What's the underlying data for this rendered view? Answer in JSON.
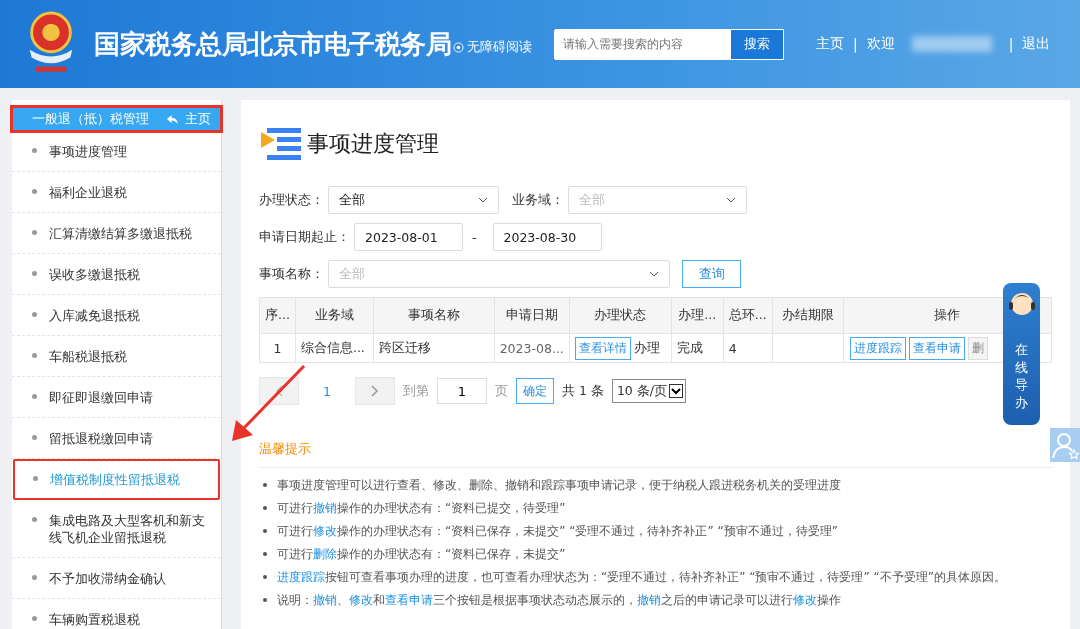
{
  "header": {
    "title": "国家税务总局北京市电子税务局",
    "accessibility": "无障碍阅读",
    "search": {
      "placeholder": "请输入需要搜索的内容"
    },
    "search_button": "搜索",
    "nav": [
      {
        "kind": "link",
        "label": "主页"
      },
      {
        "kind": "sep",
        "label": "|"
      },
      {
        "kind": "link",
        "label": "欢迎"
      },
      {
        "kind": "blurred"
      },
      {
        "kind": "sep",
        "label": "|"
      },
      {
        "kind": "link",
        "label": "退出"
      }
    ]
  },
  "sidebar": {
    "header": {
      "title": "一般退（抵）税管理",
      "home_link": "主页",
      "highlighted": true
    },
    "items": [
      {
        "label": "事项进度管理",
        "selected": false,
        "highlighted": false
      },
      {
        "label": "福利企业退税",
        "selected": false,
        "highlighted": false
      },
      {
        "label": "汇算清缴结算多缴退抵税",
        "selected": false,
        "highlighted": false
      },
      {
        "label": "误收多缴退抵税",
        "selected": false,
        "highlighted": false
      },
      {
        "label": "入库减免退抵税",
        "selected": false,
        "highlighted": false
      },
      {
        "label": "车船税退抵税",
        "selected": false,
        "highlighted": false
      },
      {
        "label": "即征即退缴回申请",
        "selected": false,
        "highlighted": false
      },
      {
        "label": "留抵退税缴回申请",
        "selected": false,
        "highlighted": false
      },
      {
        "label": "增值税制度性留抵退税",
        "selected": true,
        "highlighted": true
      },
      {
        "label": "集成电路及大型客机和新支线飞机企业留抵退税",
        "selected": false,
        "highlighted": false
      },
      {
        "label": "不予加收滞纳金确认",
        "selected": false,
        "highlighted": false
      },
      {
        "label": "车辆购置税退税",
        "selected": false,
        "highlighted": false
      }
    ]
  },
  "main": {
    "title": "事项进度管理",
    "filters": {
      "status": {
        "label": "办理状态：",
        "value": "全部"
      },
      "domain": {
        "label": "业务域：",
        "placeholder": "全部"
      },
      "date_range": {
        "label": "申请日期起止：",
        "start": "2023-08-01",
        "separator": "-",
        "end": "2023-08-30"
      },
      "item_name": {
        "label": "事项名称：",
        "placeholder": "全部"
      },
      "query_button": "查询"
    },
    "table": {
      "columns": [
        "序...",
        "业务域",
        "事项名称",
        "申请日期",
        "办理状态",
        "办理...",
        "总环...",
        "办结期限",
        "操作"
      ],
      "rows": [
        {
          "cells": [
            "1",
            "综合信息...",
            "跨区迁移",
            "2023-08...",
            "",
            "完成",
            "4",
            "",
            ""
          ],
          "status_button": "查看详情",
          "status_text": "办理",
          "actions": [
            {
              "label": "进度跟踪",
              "disabled": false
            },
            {
              "label": "查看申请",
              "disabled": false
            },
            {
              "label": "删",
              "disabled": true
            }
          ]
        }
      ]
    },
    "pagination": {
      "current_page": "1",
      "goto_label": "到第",
      "goto_value": "1",
      "page_unit": "页",
      "confirm": "确定",
      "total": "共 1 条",
      "page_size": "10 条/页"
    },
    "tips": {
      "title": "温馨提示",
      "items": [
        [
          {
            "text": "事项进度管理可以进行查看、修改、删除、撤销和跟踪事项申请记录，便于纳税人跟进税务机关的受理进度",
            "link": false
          }
        ],
        [
          {
            "text": "可进行",
            "link": false
          },
          {
            "text": "撤销",
            "link": true
          },
          {
            "text": "操作的办理状态有：“资料已提交，待受理”",
            "link": false
          }
        ],
        [
          {
            "text": "可进行",
            "link": false
          },
          {
            "text": "修改",
            "link": true
          },
          {
            "text": "操作的办理状态有：“资料已保存，未提交” “受理不通过，待补齐补正” “预审不通过，待受理”",
            "link": false
          }
        ],
        [
          {
            "text": "可进行",
            "link": false
          },
          {
            "text": "删除",
            "link": true
          },
          {
            "text": "操作的办理状态有：“资料已保存，未提交”",
            "link": false
          }
        ],
        [
          {
            "text": "进度跟踪",
            "link": true
          },
          {
            "text": "按钮可查看事项办理的进度，也可查看办理状态为：“受理不通过，待补齐补正” “预审不通过，待受理” “不予受理”的具体原因。",
            "link": false
          }
        ],
        [
          {
            "text": "说明：",
            "link": false
          },
          {
            "text": "撤销",
            "link": true
          },
          {
            "text": "、",
            "link": false
          },
          {
            "text": "修改",
            "link": true
          },
          {
            "text": "和",
            "link": false
          },
          {
            "text": "查看申请",
            "link": true
          },
          {
            "text": "三个按钮是根据事项状态动态展示的，",
            "link": false
          },
          {
            "text": "撤销",
            "link": true
          },
          {
            "text": "之后的申请记录可以进行",
            "link": false
          },
          {
            "text": "修改",
            "link": true
          },
          {
            "text": "操作",
            "link": false
          }
        ]
      ]
    }
  },
  "guide_widget": {
    "label": "在线导办"
  }
}
